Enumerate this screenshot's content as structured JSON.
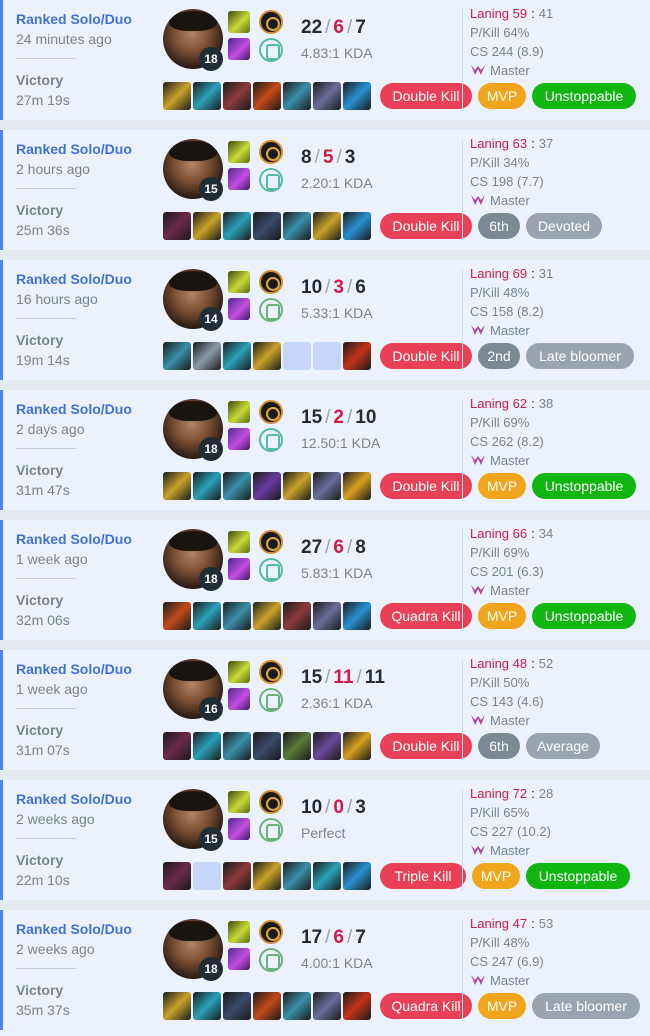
{
  "matches": [
    {
      "mode": "Ranked Solo/Duo",
      "ago": "24 minutes ago",
      "result": "Victory",
      "duration": "27m 19s",
      "level": "18",
      "kills": "22",
      "deaths": "6",
      "assists": "7",
      "ratio": "4.83:1 KDA",
      "laning": "Laning 59",
      "laning_sep": ":",
      "laning_opp": "41",
      "pkill": "P/Kill 64%",
      "cs": "CS 244 (8.9)",
      "rank": "Master",
      "secondary_rune": "inspiration-rune-icon",
      "items": [
        "#c9a32a",
        "#2aa0b8",
        "#8b3b3b",
        "#c24a1a",
        "#3a8fa8",
        "#6a6e9a",
        "#2a8fd0"
      ],
      "badges": [
        {
          "label": "Double Kill",
          "color": "#e84057"
        },
        {
          "label": "MVP",
          "color": "#f0a51c"
        },
        {
          "label": "Unstoppable",
          "color": "#10b510"
        }
      ]
    },
    {
      "mode": "Ranked Solo/Duo",
      "ago": "2 hours ago",
      "result": "Victory",
      "duration": "25m 36s",
      "level": "15",
      "kills": "8",
      "deaths": "5",
      "assists": "3",
      "ratio": "2.20:1 KDA",
      "laning": "Laning 63",
      "laning_sep": ":",
      "laning_opp": "37",
      "pkill": "P/Kill 34%",
      "cs": "CS 198 (7.7)",
      "rank": "Master",
      "secondary_rune": "inspiration-rune-icon",
      "items": [
        "#6b2a4a",
        "#c9a32a",
        "#2aa0b8",
        "#3a4a6a",
        "#3a8fa8",
        "#c9a32a",
        "#2a8fd0"
      ],
      "badges": [
        {
          "label": "Double Kill",
          "color": "#e84057"
        },
        {
          "label": "6th",
          "color": "#7b8994"
        },
        {
          "label": "Devoted",
          "color": "#9aa4af"
        }
      ]
    },
    {
      "mode": "Ranked Solo/Duo",
      "ago": "16 hours ago",
      "result": "Victory",
      "duration": "19m 14s",
      "level": "14",
      "kills": "10",
      "deaths": "3",
      "assists": "6",
      "ratio": "5.33:1 KDA",
      "laning": "Laning 69",
      "laning_sep": ":",
      "laning_opp": "31",
      "pkill": "P/Kill 48%",
      "cs": "CS 158 (8.2)",
      "rank": "Master",
      "secondary_rune": "resolve-rune-icon",
      "items": [
        "#3a8fa8",
        "#8a9aa8",
        "#2aa0b8",
        "#c9a32a",
        "empty",
        "empty",
        "#c2331a"
      ],
      "badges": [
        {
          "label": "Double Kill",
          "color": "#e84057"
        },
        {
          "label": "2nd",
          "color": "#7b8994"
        },
        {
          "label": "Late bloomer",
          "color": "#9aa4af"
        }
      ]
    },
    {
      "mode": "Ranked Solo/Duo",
      "ago": "2 days ago",
      "result": "Victory",
      "duration": "31m 47s",
      "level": "18",
      "kills": "15",
      "deaths": "2",
      "assists": "10",
      "ratio": "12.50:1 KDA",
      "laning": "Laning 62",
      "laning_sep": ":",
      "laning_opp": "38",
      "pkill": "P/Kill 69%",
      "cs": "CS 262 (8.2)",
      "rank": "Master",
      "secondary_rune": "inspiration-rune-icon",
      "items": [
        "#c9a32a",
        "#2aa0b8",
        "#3a8fa8",
        "#6a3aa0",
        "#c9a32a",
        "#6a6e9a",
        "#d8a020"
      ],
      "badges": [
        {
          "label": "Double Kill",
          "color": "#e84057"
        },
        {
          "label": "MVP",
          "color": "#f0a51c"
        },
        {
          "label": "Unstoppable",
          "color": "#10b510"
        }
      ]
    },
    {
      "mode": "Ranked Solo/Duo",
      "ago": "1 week ago",
      "result": "Victory",
      "duration": "32m 06s",
      "level": "18",
      "kills": "27",
      "deaths": "6",
      "assists": "8",
      "ratio": "5.83:1 KDA",
      "laning": "Laning 66",
      "laning_sep": ":",
      "laning_opp": "34",
      "pkill": "P/Kill 69%",
      "cs": "CS 201 (6.3)",
      "rank": "Master",
      "secondary_rune": "inspiration-rune-icon",
      "items": [
        "#c24a1a",
        "#2aa0b8",
        "#3a8fa8",
        "#c9a32a",
        "#8b3b3b",
        "#6a6e9a",
        "#2a8fd0"
      ],
      "badges": [
        {
          "label": "Quadra Kill",
          "color": "#e84057"
        },
        {
          "label": "MVP",
          "color": "#f0a51c"
        },
        {
          "label": "Unstoppable",
          "color": "#10b510"
        }
      ]
    },
    {
      "mode": "Ranked Solo/Duo",
      "ago": "1 week ago",
      "result": "Victory",
      "duration": "31m 07s",
      "level": "16",
      "kills": "15",
      "deaths": "11",
      "assists": "11",
      "ratio": "2.36:1 KDA",
      "laning": "Laning 48",
      "laning_sep": ":",
      "laning_opp": "52",
      "pkill": "P/Kill 50%",
      "cs": "CS 143 (4.6)",
      "rank": "Master",
      "secondary_rune": "resolve-rune-icon",
      "items": [
        "#6b2a4a",
        "#2aa0b8",
        "#3a8fa8",
        "#3a4a6a",
        "#5a7a3a",
        "#6a4a9a",
        "#d8a020"
      ],
      "badges": [
        {
          "label": "Double Kill",
          "color": "#e84057"
        },
        {
          "label": "6th",
          "color": "#7b8994"
        },
        {
          "label": "Average",
          "color": "#9aa4af"
        }
      ]
    },
    {
      "mode": "Ranked Solo/Duo",
      "ago": "2 weeks ago",
      "result": "Victory",
      "duration": "22m 10s",
      "level": "15",
      "kills": "10",
      "deaths": "0",
      "assists": "3",
      "ratio": "Perfect",
      "laning": "Laning 72",
      "laning_sep": ":",
      "laning_opp": "28",
      "pkill": "P/Kill 65%",
      "cs": "CS 227 (10.2)",
      "rank": "Master",
      "secondary_rune": "resolve-rune-icon",
      "items": [
        "#6b2a4a",
        "empty",
        "#8b3b3b",
        "#c9a32a",
        "#3a8fa8",
        "#2aa0b8",
        "#2a8fd0"
      ],
      "badges": [
        {
          "label": "Triple Kill",
          "color": "#e84057"
        },
        {
          "label": "MVP",
          "color": "#f0a51c"
        },
        {
          "label": "Unstoppable",
          "color": "#10b510"
        }
      ]
    },
    {
      "mode": "Ranked Solo/Duo",
      "ago": "2 weeks ago",
      "result": "Victory",
      "duration": "35m 37s",
      "level": "18",
      "kills": "17",
      "deaths": "6",
      "assists": "7",
      "ratio": "4.00:1 KDA",
      "laning": "Laning 47",
      "laning_sep": ":",
      "laning_opp": "53",
      "pkill": "P/Kill 48%",
      "cs": "CS 247 (6.9)",
      "rank": "Master",
      "secondary_rune": "resolve-rune-icon",
      "items": [
        "#c9a32a",
        "#2aa0b8",
        "#3a4a6a",
        "#c24a1a",
        "#3a8fa8",
        "#6a6e9a",
        "#c2331a"
      ],
      "badges": [
        {
          "label": "Quadra Kill",
          "color": "#e84057"
        },
        {
          "label": "MVP",
          "color": "#f0a51c"
        },
        {
          "label": "Late bloomer",
          "color": "#9aa4af"
        }
      ]
    }
  ]
}
